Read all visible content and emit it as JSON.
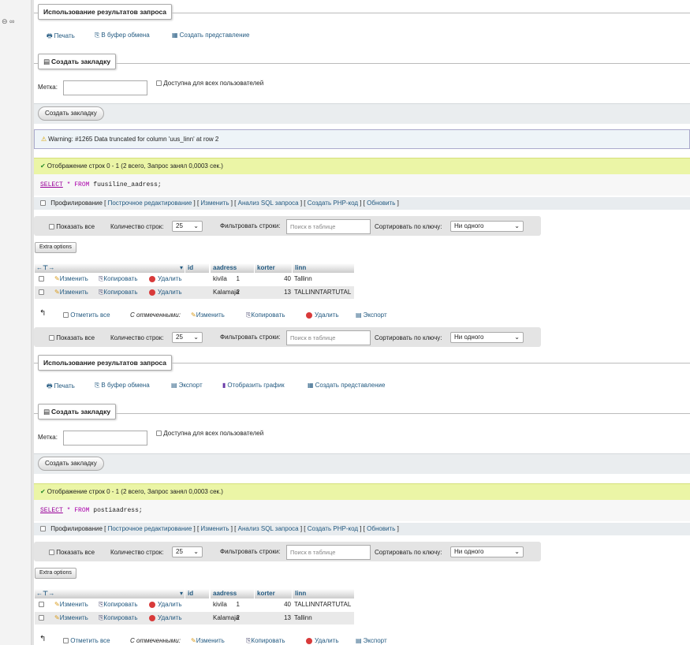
{
  "query_results_ops": {
    "title": "Использование результатов запроса",
    "print": "Печать",
    "copy_clipboard": "В буфер обмена",
    "create_view": "Создать представление",
    "export": "Экспорт",
    "display_chart": "Отобразить график"
  },
  "bookmark": {
    "title": "Создать закладку",
    "label_caption": "Метка:",
    "public_checkbox": "Доступна для всех пользователей",
    "submit": "Создать закладку"
  },
  "warning": "Warning: #1265 Data truncated for column 'uus_linn' at row 2",
  "success_message": "Отображение строк 0 - 1 (2 всего, Запрос занял 0,0003 сек.)",
  "profiling": {
    "label": "Профилирование",
    "links": [
      "Построчное редактирование",
      "Изменить",
      "Анализ SQL запроса",
      "Создать PHP-код",
      "Обновить"
    ]
  },
  "navigation": {
    "show_all": "Показать все",
    "rows_label": "Количество строк:",
    "rows_value": "25",
    "filter_label": "Фильтровать строки:",
    "filter_placeholder": "Поиск в таблице",
    "sort_label": "Сортировать по ключу:",
    "sort_value": "Ни одного"
  },
  "extra_options": "Extra options",
  "table": {
    "columns": [
      "id",
      "aadress",
      "korter",
      "linn"
    ]
  },
  "row_actions": {
    "edit": "Изменить",
    "copy": "Копировать",
    "delete": "Удалить"
  },
  "bulk": {
    "check_all": "Отметить все",
    "with_selected": "С отмеченными:",
    "edit": "Изменить",
    "copy": "Копировать",
    "delete": "Удалить",
    "export": "Экспорт"
  },
  "result1": {
    "sql_keyword": "SELECT",
    "sql_star": "*",
    "sql_from": "FROM",
    "sql_table": "fuusiline_aadress;",
    "rows": [
      {
        "id": "1",
        "aadress": "kivila",
        "korter": "40",
        "linn": "Tallinn"
      },
      {
        "id": "2",
        "aadress": "Kalamaja",
        "korter": "13",
        "linn": "TALLINNTARTUTAL"
      }
    ]
  },
  "result2": {
    "sql_keyword": "SELECT",
    "sql_star": "*",
    "sql_from": "FROM",
    "sql_table": "postiaadress;",
    "rows": [
      {
        "id": "1",
        "aadress": "kivila",
        "korter": "40",
        "linn": "TALLINNTARTUTAL"
      },
      {
        "id": "2",
        "aadress": "Kalamaja",
        "korter": "13",
        "linn": "Tallinn"
      }
    ]
  }
}
